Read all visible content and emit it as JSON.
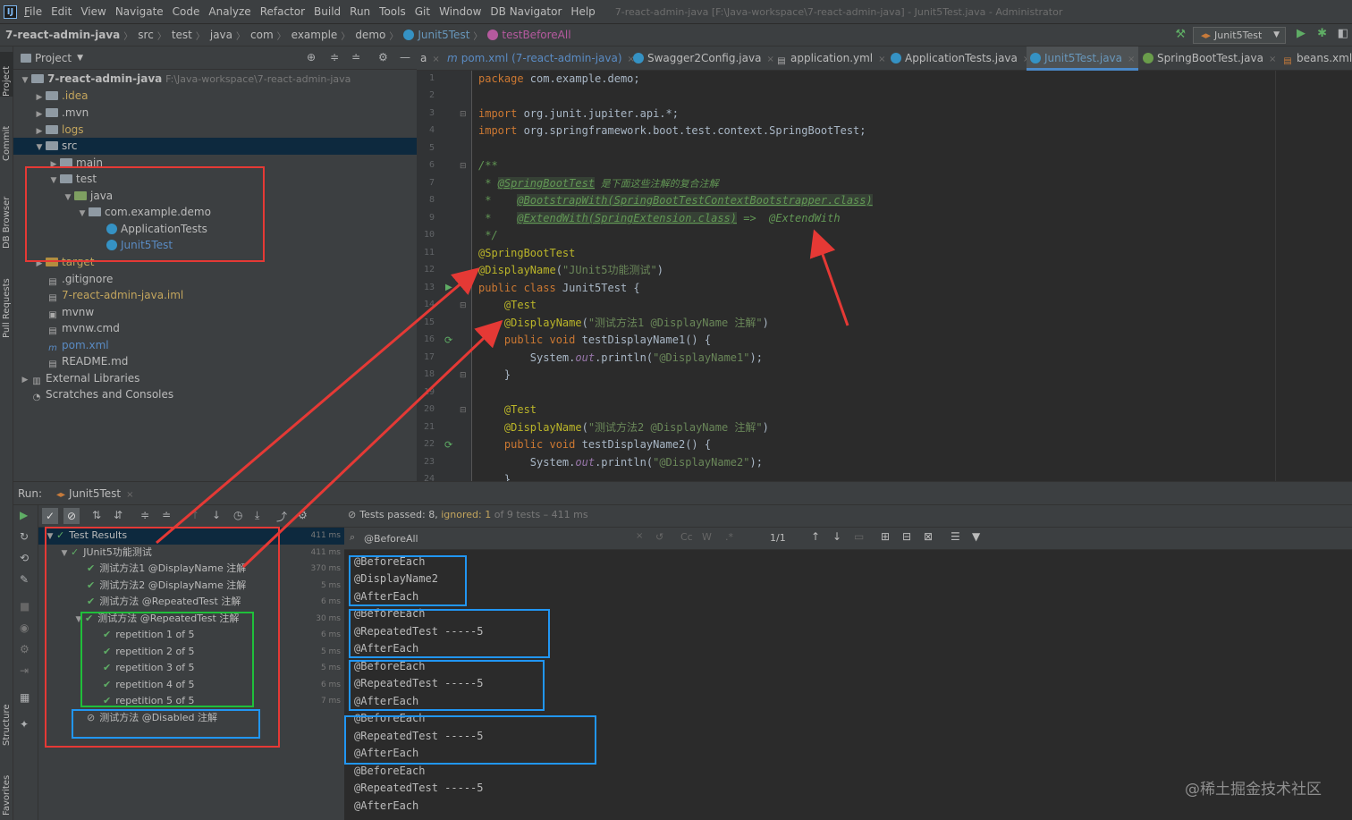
{
  "menubar": {
    "items": [
      "File",
      "Edit",
      "View",
      "Navigate",
      "Code",
      "Analyze",
      "Refactor",
      "Build",
      "Run",
      "Tools",
      "Git",
      "Window",
      "DB Navigator",
      "Help"
    ],
    "mnemonics": [
      "F",
      "E",
      "V",
      "N",
      "C",
      "z",
      "R",
      "B",
      "u",
      "T",
      "G",
      "W",
      "D",
      "H"
    ],
    "window_title": "7-react-admin-java [F:\\Java-workspace\\7-react-admin-java] - Junit5Test.java - Administrator"
  },
  "breadcrumbs": [
    "7-react-admin-java",
    "src",
    "test",
    "java",
    "com",
    "example",
    "demo",
    "Junit5Test",
    "testBeforeAll"
  ],
  "run_config": {
    "selected": "Junit5Test"
  },
  "left_strip_tabs": [
    "Project",
    "Commit",
    "DB Browser",
    "Pull Requests",
    "Structure",
    "Favorites"
  ],
  "project": {
    "view_label": "Project",
    "tree": [
      {
        "label": "7-react-admin-java",
        "path": "F:\\Java-workspace\\7-react-admin-java"
      },
      {
        "label": ".idea"
      },
      {
        "label": ".mvn"
      },
      {
        "label": "logs"
      },
      {
        "label": "src"
      },
      {
        "label": "main"
      },
      {
        "label": "test"
      },
      {
        "label": "java"
      },
      {
        "label": "com.example.demo"
      },
      {
        "label": "ApplicationTests"
      },
      {
        "label": "Junit5Test"
      },
      {
        "label": "target"
      },
      {
        "label": ".gitignore"
      },
      {
        "label": "7-react-admin-java.iml"
      },
      {
        "label": "mvnw"
      },
      {
        "label": "mvnw.cmd"
      },
      {
        "label": "pom.xml"
      },
      {
        "label": "README.md"
      },
      {
        "label": "External Libraries"
      },
      {
        "label": "Scratches and Consoles"
      }
    ]
  },
  "editor_tabs": [
    {
      "label": "a"
    },
    {
      "label": "pom.xml (7-react-admin-java)"
    },
    {
      "label": "Swagger2Config.java"
    },
    {
      "label": "application.yml"
    },
    {
      "label": "ApplicationTests.java"
    },
    {
      "label": "Junit5Test.java"
    },
    {
      "label": "SpringBootTest.java"
    },
    {
      "label": "beans.xml"
    }
  ],
  "code": {
    "line_numbers": [
      "1",
      "2",
      "3",
      "4",
      "5",
      "6",
      "7",
      "8",
      "9",
      "10",
      "11",
      "12",
      "13",
      "14",
      "15",
      "16",
      "17",
      "18",
      "19",
      "20",
      "21",
      "22",
      "23",
      "24"
    ],
    "l1_kw": "package",
    "l1_rest": " com.example.demo;",
    "l3_kw": "import",
    "l3_rest": " org.junit.jupiter.api.*;",
    "l4_kw": "import",
    "l4_rest": " org.springframework.boot.test.context.SpringBootTest;",
    "l6": "/**",
    "l7_star": " * ",
    "l7_ref": "@SpringBootTest",
    "l7_text": " 是下面这些注解的复合注解",
    "l8_star": " *    ",
    "l8_ref": "@BootstrapWith(SpringBootTestContextBootstrapper.class)",
    "l9_star": " *    ",
    "l9_ref": "@ExtendWith(SpringExtension.class)",
    "l9_text": " =>  @ExtendWith",
    "l10": " */",
    "l11": "@SpringBootTest",
    "l12_an": "@DisplayName",
    "l12_p1": "(",
    "l12_str": "\"JUnit5功能测试\"",
    "l12_p2": ")",
    "l13_kw": "public class",
    "l13_rest": " Junit5Test {",
    "l14": "    @Test",
    "l15_an": "    @DisplayName",
    "l15_p1": "(",
    "l15_str": "\"测试方法1 @DisplayName 注解\"",
    "l15_p2": ")",
    "l16_kw": "    public void",
    "l16_rest": " testDisplayName1() {",
    "l17_a": "        System.",
    "l17_out": "out",
    "l17_b": ".println(",
    "l17_str": "\"@DisplayName1\"",
    "l17_c": ");",
    "l18": "    }",
    "l20": "    @Test",
    "l21_an": "    @DisplayName",
    "l21_p1": "(",
    "l21_str": "\"测试方法2 @DisplayName 注解\"",
    "l21_p2": ")",
    "l22_kw": "    public void",
    "l22_rest": " testDisplayName2() {",
    "l23_a": "        System.",
    "l23_out": "out",
    "l23_b": ".println(",
    "l23_str": "\"@DisplayName2\"",
    "l23_c": ");",
    "l24": "    }"
  },
  "run": {
    "label": "Run:",
    "tab": "Junit5Test",
    "status_prefix": "Tests passed: 8,",
    "status_ignored": "ignored: 1",
    "status_suffix": "of 9 tests – 411 ms",
    "search_value": "@BeforeAll",
    "match_count": "1/1",
    "search_opts": [
      "Cc",
      "W"
    ]
  },
  "test_tree": [
    {
      "label": "Test Results",
      "time": "411 ms"
    },
    {
      "label": "JUnit5功能测试",
      "time": "411 ms"
    },
    {
      "label": "测试方法1 @DisplayName 注解",
      "time": "370 ms"
    },
    {
      "label": "测试方法2 @DisplayName 注解",
      "time": "5 ms"
    },
    {
      "label": "测试方法 @RepeatedTest 注解",
      "time": "6 ms"
    },
    {
      "label": "测试方法 @RepeatedTest 注解",
      "time": "30 ms"
    },
    {
      "label": "repetition 1 of 5",
      "time": "6 ms"
    },
    {
      "label": "repetition 2 of 5",
      "time": "5 ms"
    },
    {
      "label": "repetition 3 of 5",
      "time": "5 ms"
    },
    {
      "label": "repetition 4 of 5",
      "time": "6 ms"
    },
    {
      "label": "repetition 5 of 5",
      "time": "7 ms"
    },
    {
      "label": "测试方法 @Disabled 注解",
      "time": ""
    }
  ],
  "console_lines": [
    "@BeforeEach",
    "@DisplayName2",
    "@AfterEach",
    "@BeforeEach",
    "@RepeatedTest -----5",
    "@AfterEach",
    "@BeforeEach",
    "@RepeatedTest -----5",
    "@AfterEach",
    "@BeforeEach",
    "@RepeatedTest -----5",
    "@AfterEach",
    "@BeforeEach",
    "@RepeatedTest -----5",
    "@AfterEach"
  ],
  "watermark": "@稀土掘金技术社区",
  "colors": {
    "annotation_red": "#e53935",
    "annotation_green": "#1fbf3a",
    "annotation_blue": "#2196f3",
    "selection": "#0d293e",
    "pass_green": "#5fad65"
  }
}
